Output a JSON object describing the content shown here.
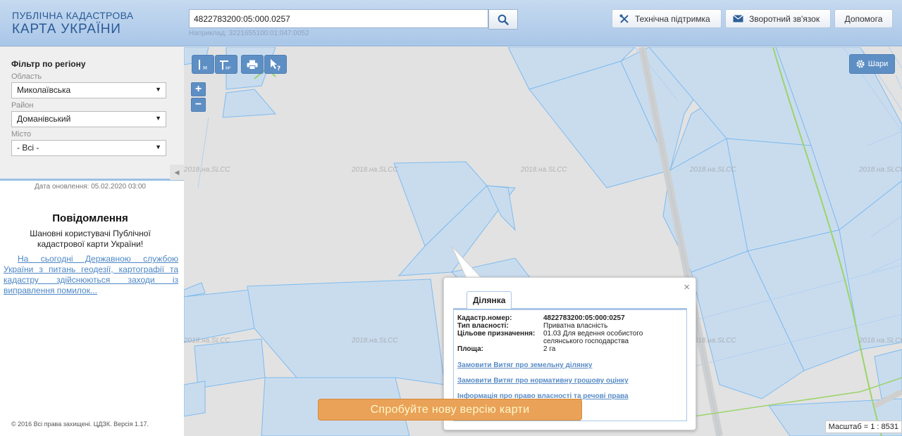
{
  "header": {
    "logo_line1": "ПУБЛІЧНА КАДАСТРОВА",
    "logo_line2": "КАРТА УКРАЇНИ",
    "search_value": "4822783200:05:000.0257",
    "search_hint": "Наприклад: 3221655100:01:047:0052",
    "buttons": [
      {
        "label": "Технічна підтримка",
        "icon": "tools-icon"
      },
      {
        "label": "Зворотний зв'язок",
        "icon": "envelope-icon"
      },
      {
        "label": "Допомога"
      }
    ]
  },
  "filter": {
    "title": "Фільтр по регіону",
    "region_label": "Область",
    "region_value": "Миколаївська",
    "district_label": "Район",
    "district_value": "Доманівський",
    "city_label": "Місто",
    "city_value": "- Всі -"
  },
  "sidebar": {
    "update_date": "Дата оновлення: 05.02.2020 03:00",
    "notice_title": "Повідомлення",
    "notice_text": "Шановні користувачі Публічної кадастрової карти України!",
    "notice_link": "На сьогодні Державною службою України з питань геодезії, картографії та кадастру здійснюються заходи із виправлення помилок...",
    "copyright": "© 2016 Всі права захищені. ЦДЗК. Версія 1.17."
  },
  "map": {
    "watermark": "2018.на.SLCC",
    "tools": [
      "ruler-m-icon",
      "ruler-area-icon",
      "print-icon",
      "identify-icon"
    ],
    "zoom_in": "+",
    "zoom_out": "−",
    "layers_label": "Шари",
    "new_version_label": "Спробуйте нову версію карти",
    "scale": "Масштаб = 1 : 8531"
  },
  "popup": {
    "tab": "Ділянка",
    "close": "×",
    "fields": [
      {
        "key": "Кадастр.номер:",
        "value": "4822783200:05:000:0257"
      },
      {
        "key": "Тип власності:",
        "value": "Приватна власність"
      },
      {
        "key": "Цільове призначення:",
        "value": "01.03 Для ведення особистого селянського господарства"
      },
      {
        "key": "Площа:",
        "value": "2 га"
      }
    ],
    "links": [
      "Замовити Витяг про земельну ділянку",
      "Замовити Витяг про нормативну грошову оцінку",
      "Інформація про право власності та речові права"
    ]
  },
  "colors": {
    "header": "#b4cfeb",
    "parcel_fill": "#c9dcee",
    "parcel_stroke": "#7fbbee",
    "road": "#9bd46a",
    "button": "#5e8fc4",
    "new_version": "#e9a257"
  }
}
